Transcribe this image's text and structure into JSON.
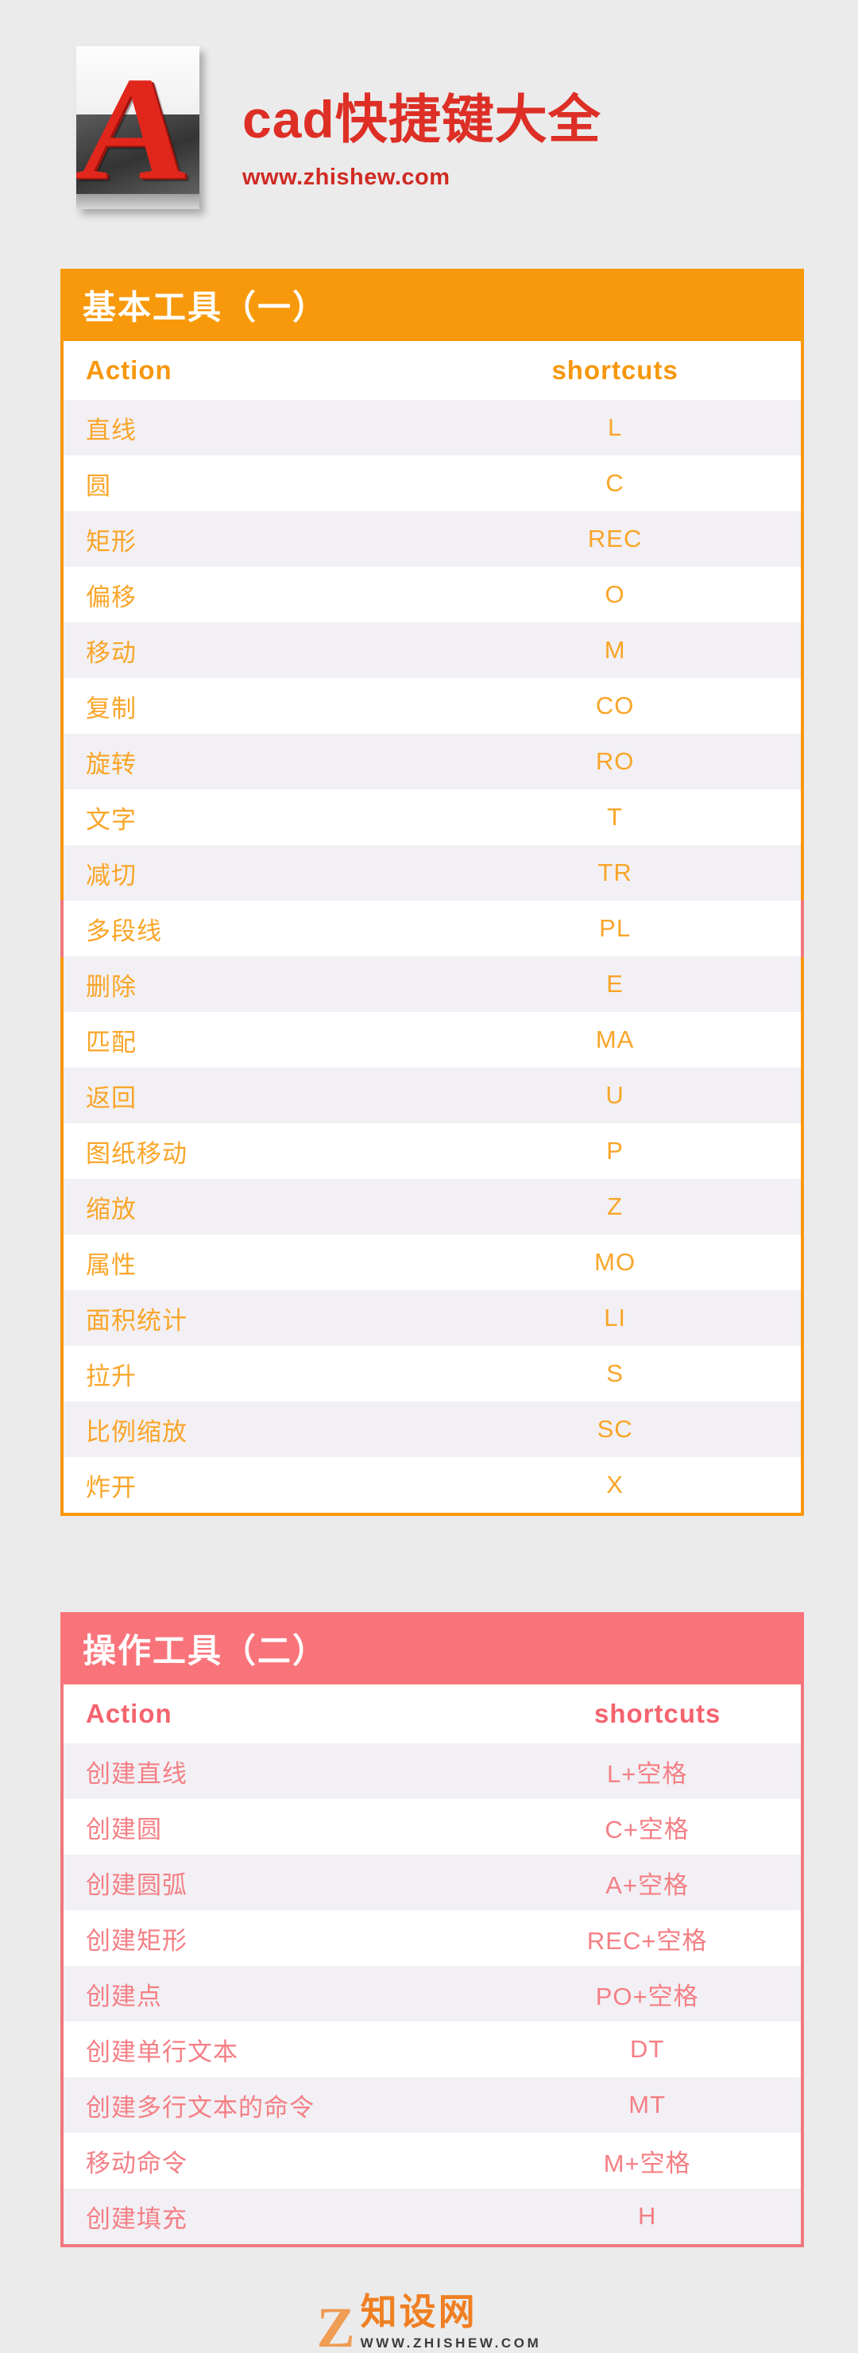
{
  "header": {
    "logo_icon": "autocad-logo-icon",
    "logo_letter": "A",
    "title": "cad快捷键大全",
    "url": "www.zhishew.com"
  },
  "colors": {
    "page_background": "#ebebeb",
    "title_red": "#dd2f26",
    "orange_header": "#f8990b",
    "orange_border": "#f7970d",
    "orange_text": "#f9a528",
    "pink_header": "#f9747a",
    "pink_border": "#f1777e",
    "pink_text": "#f47f85",
    "row_alt": "#f2f0f4",
    "row_base": "#ffffff"
  },
  "tables": [
    {
      "title": "基本工具（一）",
      "accent": "orange",
      "columns": {
        "action": "Action",
        "shortcut": "shortcuts"
      },
      "rows": [
        {
          "action": "直线",
          "shortcut": "L"
        },
        {
          "action": "圆",
          "shortcut": "C"
        },
        {
          "action": "矩形",
          "shortcut": "REC"
        },
        {
          "action": "偏移",
          "shortcut": "O"
        },
        {
          "action": "移动",
          "shortcut": "M"
        },
        {
          "action": "复制",
          "shortcut": "CO"
        },
        {
          "action": "旋转",
          "shortcut": "RO"
        },
        {
          "action": "文字",
          "shortcut": "T"
        },
        {
          "action": "减切",
          "shortcut": "TR"
        },
        {
          "action": "多段线",
          "shortcut": "PL"
        },
        {
          "action": "删除",
          "shortcut": "E"
        },
        {
          "action": "匹配",
          "shortcut": "MA"
        },
        {
          "action": "返回",
          "shortcut": "U"
        },
        {
          "action": "图纸移动",
          "shortcut": "P"
        },
        {
          "action": "缩放",
          "shortcut": "Z"
        },
        {
          "action": "属性",
          "shortcut": "MO"
        },
        {
          "action": "面积统计",
          "shortcut": "LI"
        },
        {
          "action": "拉升",
          "shortcut": "S"
        },
        {
          "action": "比例缩放",
          "shortcut": "SC"
        },
        {
          "action": "炸开",
          "shortcut": "X"
        }
      ]
    },
    {
      "title": "操作工具（二）",
      "accent": "pink",
      "columns": {
        "action": "Action",
        "shortcut": "shortcuts"
      },
      "rows": [
        {
          "action": "创建直线",
          "shortcut": "L+空格"
        },
        {
          "action": "创建圆",
          "shortcut": "C+空格"
        },
        {
          "action": "创建圆弧",
          "shortcut": "A+空格"
        },
        {
          "action": "创建矩形",
          "shortcut": "REC+空格"
        },
        {
          "action": "创建点",
          "shortcut": "PO+空格"
        },
        {
          "action": "创建单行文本",
          "shortcut": "DT"
        },
        {
          "action": "创建多行文本的命令",
          "shortcut": "MT"
        },
        {
          "action": "移动命令",
          "shortcut": "M+空格"
        },
        {
          "action": "创建填充",
          "shortcut": "H"
        }
      ]
    }
  ],
  "footer": {
    "mark": "Z",
    "brand_cn": "知设网",
    "brand_url": "WWW.ZHISHEW.COM"
  }
}
